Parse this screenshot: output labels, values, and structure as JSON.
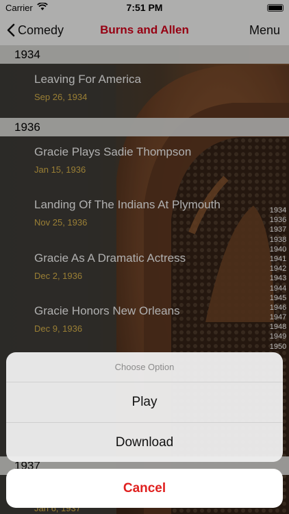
{
  "status_bar": {
    "carrier": "Carrier",
    "time": "7:51 PM",
    "icons": [
      "wifi-icon",
      "battery-icon"
    ]
  },
  "nav": {
    "back_label": "Comedy",
    "title": "Burns and Allen",
    "menu_label": "Menu",
    "title_color": "#d0021b"
  },
  "sections": [
    {
      "header": "1934",
      "rows": [
        {
          "title": "Leaving For America",
          "date": "Sep 26, 1934"
        }
      ]
    },
    {
      "header": "1936",
      "rows": [
        {
          "title": "Gracie Plays Sadie Thompson",
          "date": "Jan 15, 1936"
        },
        {
          "title": "Landing Of The Indians At Plymouth",
          "date": "Nov 25, 1936"
        },
        {
          "title": "Gracie As A Dramatic Actress",
          "date": "Dec 2, 1936"
        },
        {
          "title": "Gracie Honors New Orleans",
          "date": "Dec 9, 1936"
        }
      ]
    },
    {
      "header": "1937",
      "rows": [
        {
          "title": "",
          "date": "Jan 6, 1937"
        }
      ]
    }
  ],
  "section_index": [
    "1934",
    "1936",
    "1937",
    "1938",
    "1940",
    "1941",
    "1942",
    "1943",
    "1944",
    "1945",
    "1946",
    "1947",
    "1948",
    "1949",
    "1950"
  ],
  "action_sheet": {
    "caption": "Choose Option",
    "play_label": "Play",
    "download_label": "Download",
    "cancel_label": "Cancel",
    "cancel_color": "#e0201f"
  }
}
